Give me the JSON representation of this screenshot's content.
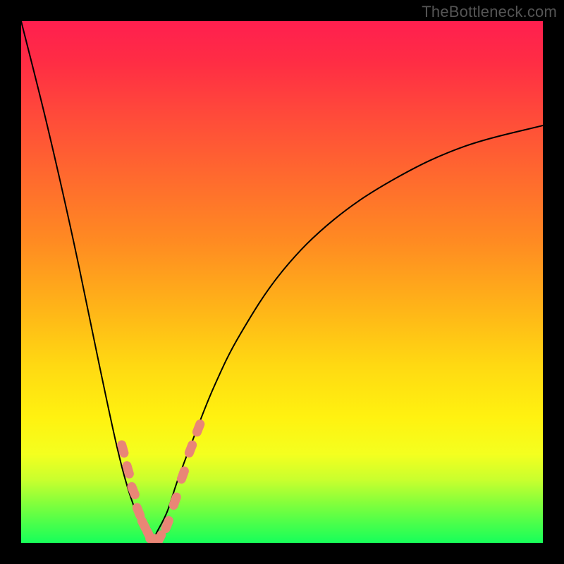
{
  "watermark": "TheBottleneck.com",
  "chart_data": {
    "type": "line",
    "title": "",
    "xlabel": "",
    "ylabel": "",
    "xlim": [
      0,
      100
    ],
    "ylim": [
      0,
      100
    ],
    "grid": false,
    "legend": false,
    "background": "gradient-red-yellow-green-vertical",
    "series": [
      {
        "name": "bottleneck-curve",
        "description": "Absolute-deviation-style V curve touching zero near x≈25, rising steeply to 100 at x=0 and gradually toward ~80 at x=100",
        "x": [
          0,
          5,
          10,
          15,
          18,
          20,
          22,
          24,
          25,
          26,
          28,
          30,
          33,
          37,
          42,
          50,
          60,
          72,
          85,
          100
        ],
        "y": [
          100,
          80,
          58,
          34,
          20,
          12,
          6,
          2,
          0,
          2,
          6,
          12,
          20,
          30,
          40,
          52,
          62,
          70,
          76,
          80
        ]
      }
    ],
    "markers": {
      "description": "Salmon-colored pill markers clustered along the curve near the minimum on both arms",
      "points": [
        {
          "x": 19.5,
          "y": 18
        },
        {
          "x": 20.5,
          "y": 14
        },
        {
          "x": 21.5,
          "y": 10
        },
        {
          "x": 22.5,
          "y": 6
        },
        {
          "x": 23.5,
          "y": 3.5
        },
        {
          "x": 24.5,
          "y": 1.5
        },
        {
          "x": 25.5,
          "y": 0.8
        },
        {
          "x": 26.5,
          "y": 0.8
        },
        {
          "x": 28.0,
          "y": 3.5
        },
        {
          "x": 29.5,
          "y": 8
        },
        {
          "x": 31.0,
          "y": 13
        },
        {
          "x": 32.5,
          "y": 18
        },
        {
          "x": 34.0,
          "y": 22
        }
      ],
      "color": "#e98676"
    }
  }
}
